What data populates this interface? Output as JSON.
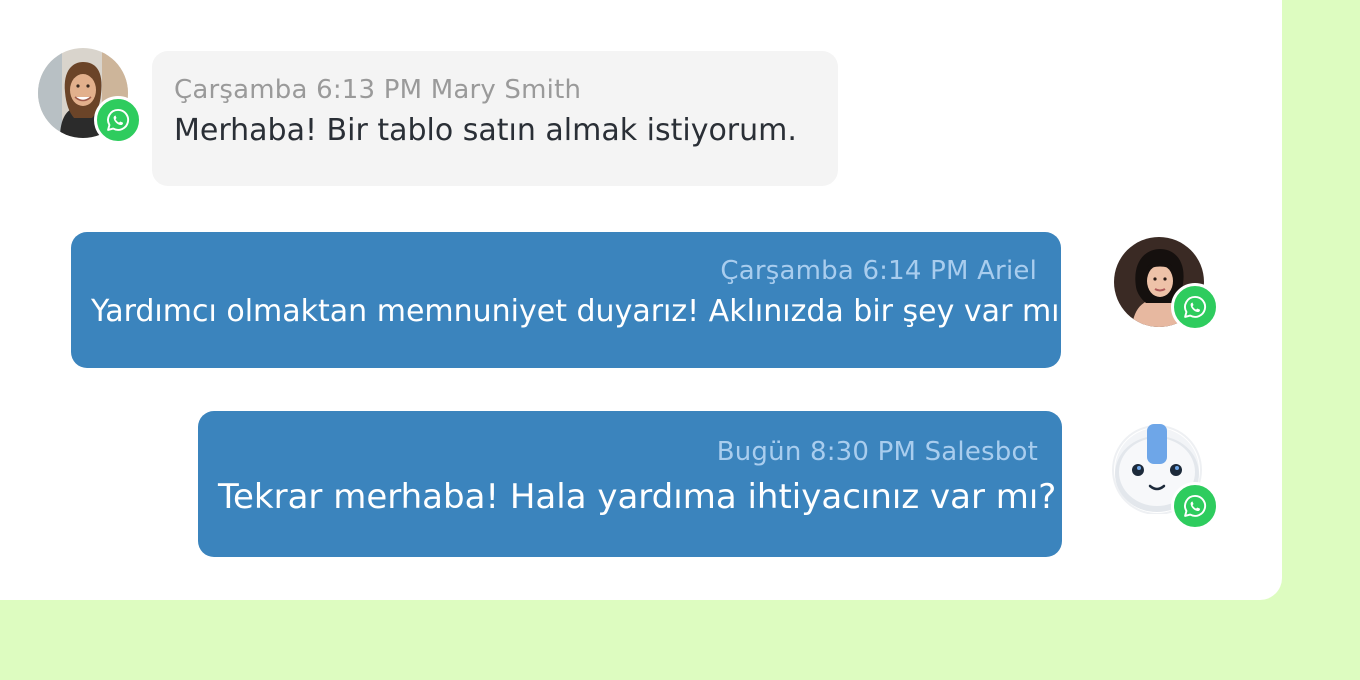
{
  "colors": {
    "background": "#ddfcc0",
    "panel": "#ffffff",
    "incoming_bubble": "#f4f4f4",
    "outgoing_bubble": "#3b84bd",
    "whatsapp_badge": "#2ecc5e"
  },
  "messages": [
    {
      "direction": "incoming",
      "avatar_icon": "customer-photo-avatar",
      "channel_icon": "whatsapp-icon",
      "meta": "Çarşamba 6:13 PM Mary Smith",
      "text": "Merhaba! Bir tablo satın almak istiyorum."
    },
    {
      "direction": "outgoing",
      "avatar_icon": "agent-photo-avatar",
      "channel_icon": "whatsapp-icon",
      "meta": "Çarşamba 6:14 PM Ariel",
      "text": "Yardımcı olmaktan memnuniyet duyarız! Aklınızda bir şey var mı?"
    },
    {
      "direction": "outgoing",
      "avatar_icon": "robot-avatar",
      "channel_icon": "whatsapp-icon",
      "meta": "Bugün  8:30 PM Salesbot",
      "text": "Tekrar merhaba! Hala yardıma ihtiyacınız var mı?"
    }
  ]
}
